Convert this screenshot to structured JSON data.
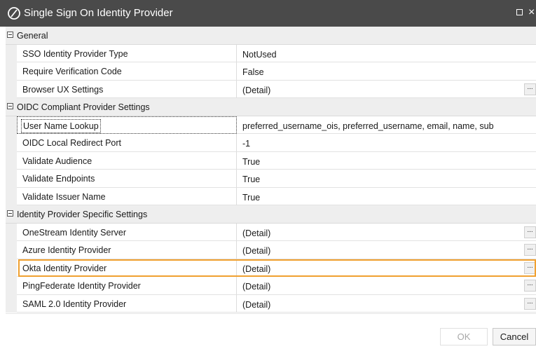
{
  "window": {
    "title": "Single Sign On Identity Provider",
    "icon": "onestream-logo-icon"
  },
  "categories": [
    {
      "label": "General",
      "properties": [
        {
          "name": "SSO Identity Provider Type",
          "value": "NotUsed",
          "has_button": false
        },
        {
          "name": "Require Verification Code",
          "value": "False",
          "has_button": false
        },
        {
          "name": "Browser UX Settings",
          "value": "(Detail)",
          "has_button": true
        }
      ]
    },
    {
      "label": "OIDC Compliant Provider Settings",
      "properties": [
        {
          "name": "User Name Lookup",
          "value": "preferred_username_ois, preferred_username, email, name, sub",
          "has_button": false,
          "focused": true
        },
        {
          "name": "OIDC Local Redirect Port",
          "value": "-1",
          "has_button": false
        },
        {
          "name": "Validate Audience",
          "value": "True",
          "has_button": false
        },
        {
          "name": "Validate Endpoints",
          "value": "True",
          "has_button": false
        },
        {
          "name": "Validate Issuer Name",
          "value": "True",
          "has_button": false
        }
      ]
    },
    {
      "label": "Identity Provider Specific Settings",
      "properties": [
        {
          "name": "OneStream Identity Server",
          "value": "(Detail)",
          "has_button": true
        },
        {
          "name": "Azure Identity Provider",
          "value": "(Detail)",
          "has_button": true
        },
        {
          "name": "Okta Identity Provider",
          "value": "(Detail)",
          "has_button": true,
          "selected": true
        },
        {
          "name": "PingFederate Identity Provider",
          "value": "(Detail)",
          "has_button": true
        },
        {
          "name": "SAML 2.0 Identity Provider",
          "value": "(Detail)",
          "has_button": true
        }
      ]
    }
  ],
  "ellipsis_label": "...",
  "buttons": {
    "ok_label": "OK",
    "cancel_label": "Cancel"
  },
  "colors": {
    "titlebar": "#4a4a4a",
    "selection_border": "#f0a030",
    "category_background": "#eeeeee"
  }
}
